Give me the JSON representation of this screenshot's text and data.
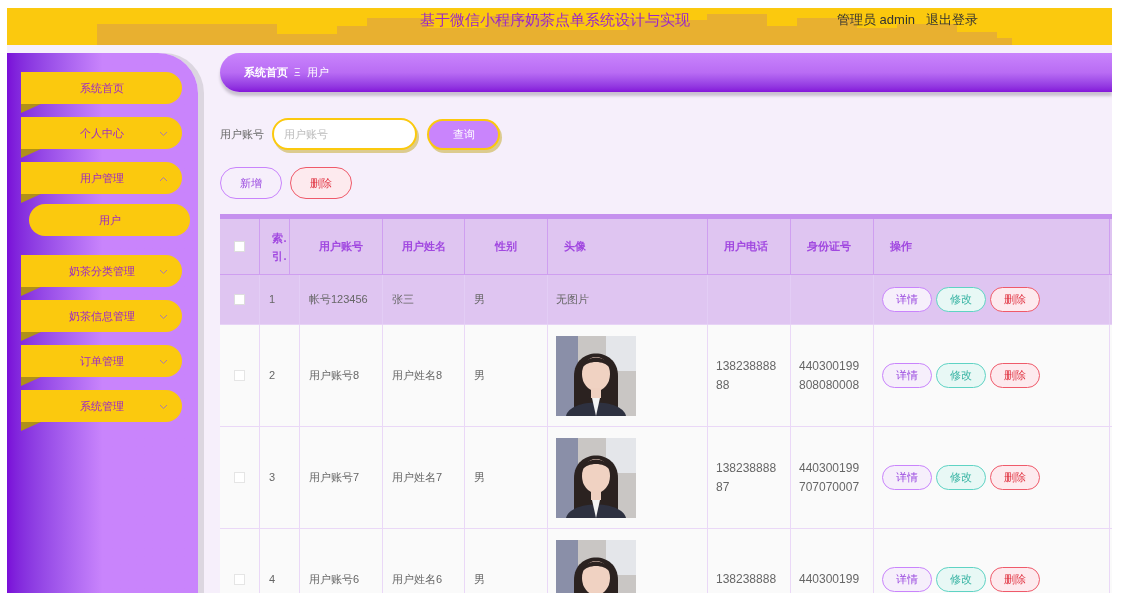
{
  "header": {
    "title": "基于微信小程序奶茶点单系统设计与实现",
    "user": "管理员 admin",
    "logout": "退出登录"
  },
  "sidebar": {
    "items": [
      {
        "label": "系统首页",
        "has_children": false
      },
      {
        "label": "个人中心",
        "has_children": true,
        "expanded": false
      },
      {
        "label": "用户管理",
        "has_children": true,
        "expanded": true,
        "children": [
          {
            "label": "用户",
            "selected": true
          }
        ]
      },
      {
        "label": "奶茶分类管理",
        "has_children": true,
        "expanded": false
      },
      {
        "label": "奶茶信息管理",
        "has_children": true,
        "expanded": false
      },
      {
        "label": "订单管理",
        "has_children": true,
        "expanded": false
      },
      {
        "label": "系统管理",
        "has_children": true,
        "expanded": false
      }
    ]
  },
  "breadcrumb": {
    "items": [
      "系统首页",
      "用户"
    ],
    "separator": "Ξ"
  },
  "search": {
    "label": "用户账号",
    "placeholder": "用户账号",
    "button": "查询"
  },
  "actions": [
    {
      "label": "新增",
      "kind": "add"
    },
    {
      "label": "删除",
      "kind": "delete"
    }
  ],
  "table": {
    "select_all": {
      "checked": false
    },
    "columns": [
      "索.引.",
      "用户账号",
      "用户姓名",
      "性别",
      "头像",
      "用户电话",
      "身份证号",
      "操作"
    ],
    "rows": [
      {
        "selected": true,
        "checked": false,
        "index": "1",
        "account": "帐号123456",
        "name": "张三",
        "gender": "男",
        "avatar": {
          "kind": "text",
          "text": "无图片"
        },
        "phone": "",
        "id_number": "",
        "actions": [
          "详情",
          "修改",
          "删除"
        ]
      },
      {
        "selected": false,
        "checked": false,
        "index": "2",
        "account": "用户账号8",
        "name": "用户姓名8",
        "gender": "男",
        "avatar": {
          "kind": "picture"
        },
        "phone": "13823888888",
        "id_number": "440300199808080008",
        "actions": [
          "详情",
          "修改",
          "删除"
        ]
      },
      {
        "selected": false,
        "checked": false,
        "index": "3",
        "account": "用户账号7",
        "name": "用户姓名7",
        "gender": "男",
        "avatar": {
          "kind": "picture"
        },
        "phone": "13823888887",
        "id_number": "440300199707070007",
        "actions": [
          "详情",
          "修改",
          "删除"
        ]
      },
      {
        "selected": false,
        "checked": false,
        "index": "4",
        "account": "用户账号6",
        "name": "用户姓名6",
        "gender": "男",
        "avatar": {
          "kind": "picture"
        },
        "phone": "138238888",
        "id_number": "440300199",
        "actions": [
          "详情",
          "修改",
          "删除"
        ]
      }
    ]
  }
}
